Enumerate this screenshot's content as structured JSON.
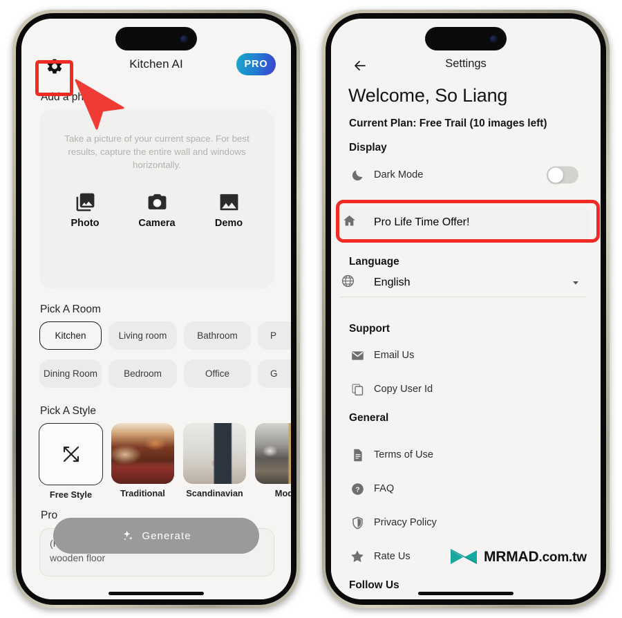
{
  "left_phone": {
    "app": {
      "title": "Kitchen AI",
      "pro_badge": "PRO",
      "gear_icon": "gear-icon"
    },
    "add_photo_label": "Add a photo",
    "photo_card": {
      "hint": "Take a picture of your current space. For best results, capture the entire wall and windows horizontally.",
      "actions": [
        {
          "label": "Photo",
          "icon": "photo-library-icon"
        },
        {
          "label": "Camera",
          "icon": "camera-icon"
        },
        {
          "label": "Demo",
          "icon": "image-icon"
        }
      ]
    },
    "pick_a_room": {
      "heading": "Pick A Room",
      "row1": [
        {
          "label": "Kitchen",
          "selected": true
        },
        {
          "label": "Living room",
          "selected": false
        },
        {
          "label": "Bathroom",
          "selected": false
        },
        {
          "label": "P",
          "selected": false
        }
      ],
      "row2": [
        {
          "label": "Dining Room",
          "selected": false
        },
        {
          "label": "Bedroom",
          "selected": false
        },
        {
          "label": "Office",
          "selected": false
        },
        {
          "label": "G",
          "selected": false
        }
      ]
    },
    "pick_a_style": {
      "heading": "Pick A Style",
      "cards": [
        {
          "label": "Free Style",
          "kind": "free",
          "icon": "shuffle-icon"
        },
        {
          "label": "Traditional",
          "kind": "trad"
        },
        {
          "label": "Scandinavian",
          "kind": "scan"
        },
        {
          "label": "Mode",
          "kind": "mod"
        }
      ]
    },
    "prompt": {
      "label": "Pro",
      "placeholder": "(Please use English) For example: white wall, wooden floor"
    },
    "generate_button": {
      "label": "Generate",
      "icon": "sparkles-icon"
    }
  },
  "right_phone": {
    "nav": {
      "back_icon": "arrow-left-icon",
      "title": "Settings"
    },
    "welcome": "Welcome, So Liang",
    "current_plan": "Current Plan: Free Trail (10 images left)",
    "sections": [
      {
        "heading": "Display",
        "rows": [
          {
            "label": "Dark Mode",
            "icon": "moon-icon",
            "control": "toggle",
            "toggle_on": false
          },
          {
            "label": "Pro Life Time Offer!",
            "icon": "home-icon",
            "control": "none",
            "highlighted": true
          }
        ]
      },
      {
        "heading": "Language",
        "rows": [
          {
            "label": "English",
            "icon": "globe-icon",
            "control": "dropdown"
          }
        ]
      },
      {
        "heading": "Support",
        "rows": [
          {
            "label": "Email Us",
            "icon": "mail-icon",
            "control": "none"
          },
          {
            "label": "Copy User Id",
            "icon": "copy-icon",
            "control": "none"
          }
        ]
      },
      {
        "heading": "General",
        "rows": [
          {
            "label": "Terms of Use",
            "icon": "document-icon",
            "control": "none"
          },
          {
            "label": "FAQ",
            "icon": "question-circle-icon",
            "control": "none"
          },
          {
            "label": "Privacy Policy",
            "icon": "shield-icon",
            "control": "none"
          },
          {
            "label": "Rate Us",
            "icon": "star-icon",
            "control": "none"
          }
        ]
      }
    ],
    "follow_us": "Follow Us"
  },
  "watermark": {
    "brand": "MRMAD",
    "domain": ".com.tw",
    "logo_icon": "mrmad-bowtie-logo-icon",
    "color": "#17a8a0"
  },
  "annotations": {
    "highlight_color": "#f22a25",
    "cursor_icon": "arrow-cursor-icon",
    "boxes": [
      "gear-button-highlight",
      "pro-life-time-offer-highlight"
    ]
  }
}
